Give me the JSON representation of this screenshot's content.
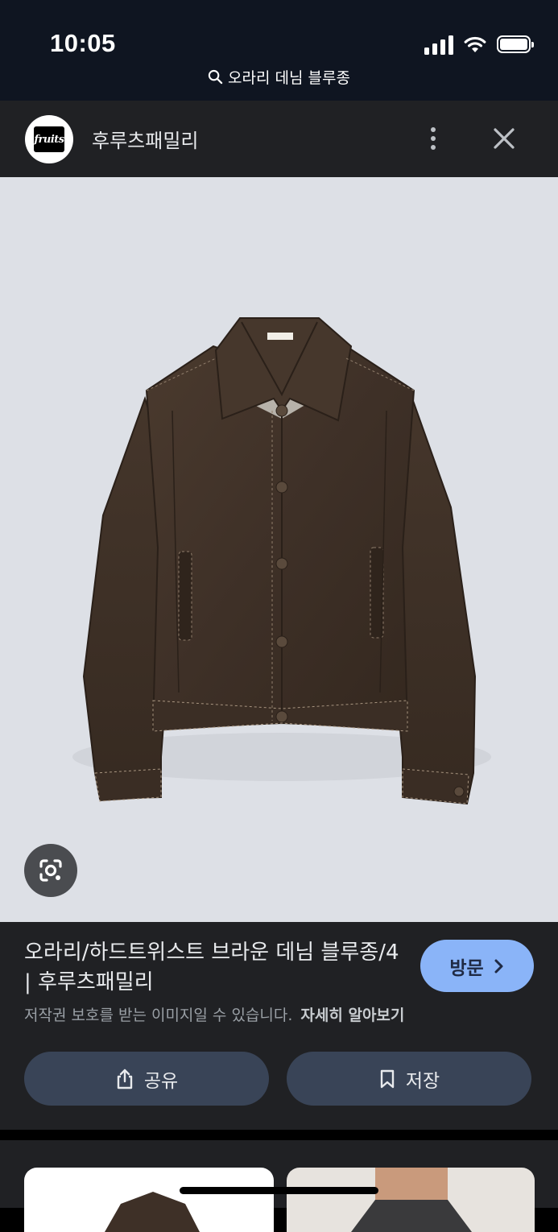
{
  "status_bar": {
    "time": "10:05",
    "signal_icon": "cellular-signal-icon",
    "wifi_icon": "wifi-icon",
    "battery_icon": "battery-icon",
    "battery_level": 1.0
  },
  "search": {
    "icon": "search-icon",
    "query": "오라리 데님 블루종"
  },
  "site": {
    "logo_text": "fruits",
    "name": "후루츠패밀리",
    "more_icon": "more-vert-icon",
    "close_icon": "close-icon"
  },
  "image": {
    "tag_text": "AURALEE",
    "lens_icon": "google-lens-icon"
  },
  "result": {
    "title": "오라리/하드트위스트 브라운 데님 블루종/4 | 후루츠패밀리",
    "visit_label": "방문",
    "visit_icon": "chevron-right-icon",
    "copyright_notice": "저작권 보호를 받는 이미지일 수 있습니다.",
    "learn_more": "자세히 알아보기",
    "share_label": "공유",
    "share_icon": "share-icon",
    "save_label": "저장",
    "save_icon": "bookmark-icon"
  }
}
